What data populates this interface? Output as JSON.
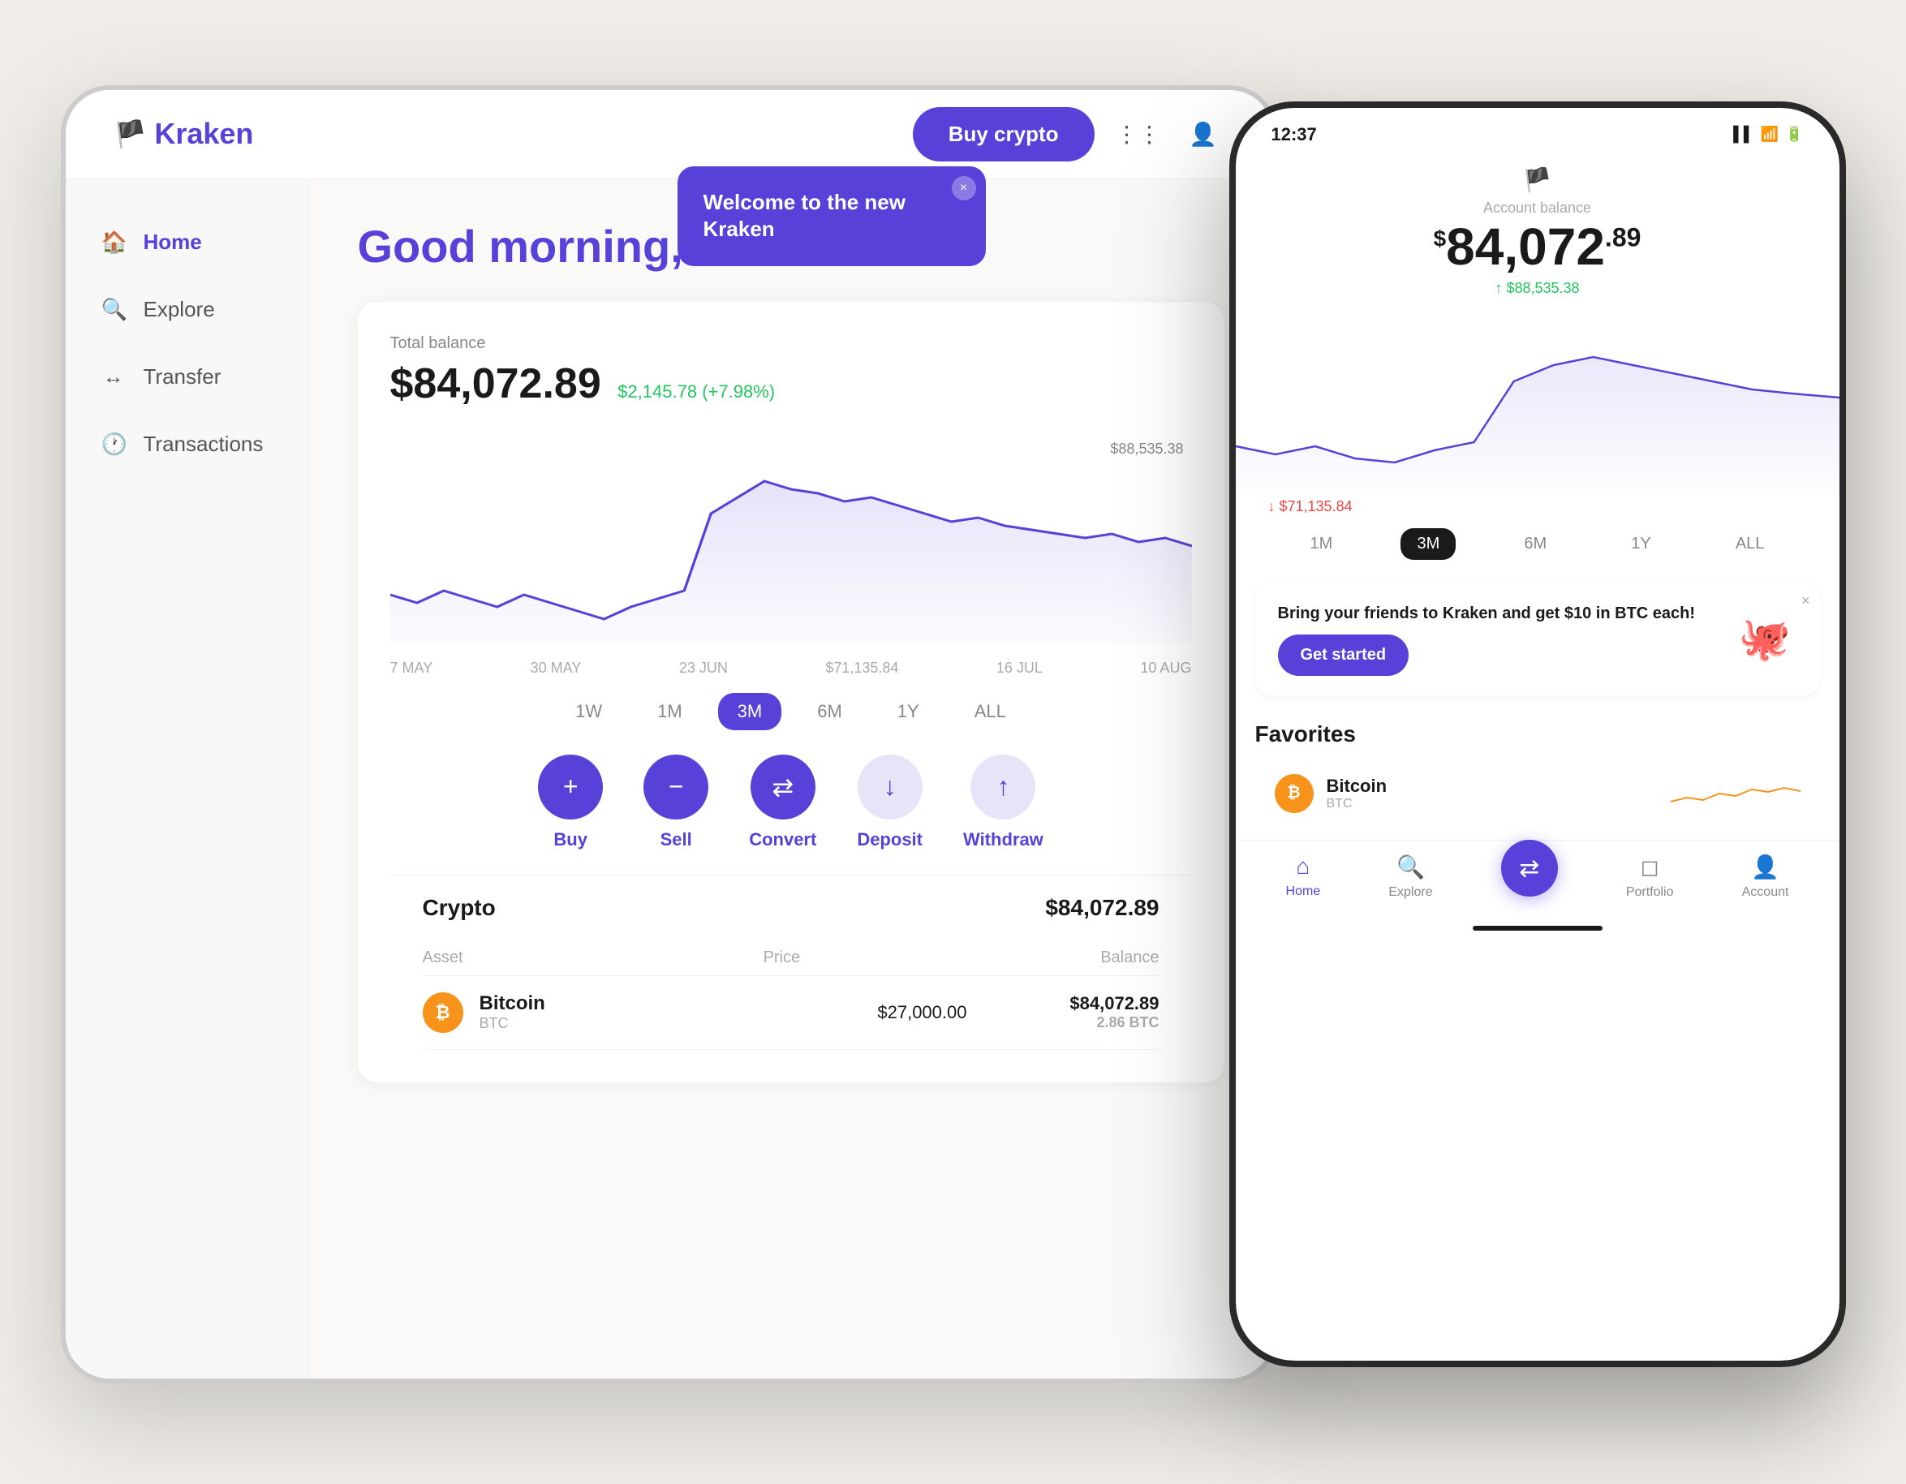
{
  "app": {
    "name": "Kraken"
  },
  "header": {
    "buy_crypto_label": "Buy crypto",
    "logo_text": "kraken"
  },
  "sidebar": {
    "items": [
      {
        "label": "Home",
        "icon": "🏠",
        "active": true
      },
      {
        "label": "Explore",
        "icon": "🔍",
        "active": false
      },
      {
        "label": "Transfer",
        "icon": "↔",
        "active": false
      },
      {
        "label": "Transactions",
        "icon": "🕐",
        "active": false
      }
    ]
  },
  "main": {
    "greeting": "Good morning, Satoshi",
    "balance": {
      "label": "Total balance",
      "amount": "$84,072.89",
      "amount_main": "$84,072.89",
      "change": "$2,145.78 (+7.98%)"
    },
    "chart": {
      "high_label": "$88,535.38",
      "low_label": "$71,135.84",
      "x_labels": [
        "7 MAY",
        "30 MAY",
        "23 JUN",
        "16 JUL",
        "10 AUG"
      ]
    },
    "time_filters": [
      "1W",
      "1M",
      "3M",
      "6M",
      "1Y",
      "ALL"
    ],
    "active_filter": "3M",
    "action_buttons": [
      {
        "label": "Buy",
        "icon": "+",
        "type": "primary"
      },
      {
        "label": "Sell",
        "icon": "−",
        "type": "primary"
      },
      {
        "label": "Convert",
        "icon": "⇄",
        "type": "primary"
      },
      {
        "label": "Deposit",
        "icon": "↓",
        "type": "light"
      },
      {
        "label": "Withdraw",
        "icon": "↑",
        "type": "light"
      }
    ],
    "assets": {
      "title": "Crypto",
      "total": "$84,072.89",
      "columns": [
        "Asset",
        "Price",
        "Balance"
      ],
      "rows": [
        {
          "name": "Bitcoin",
          "ticker": "BTC",
          "price": "$27,000.00",
          "balance": "$84,072.89",
          "sub_balance": "2.86 BTC"
        }
      ]
    }
  },
  "popup": {
    "title": "Welcome to the new Kraken",
    "close_label": "×"
  },
  "phone": {
    "status_bar": {
      "time": "12:37",
      "signal": "▌▌",
      "wifi": "WiFi",
      "battery": "🔋"
    },
    "balance": {
      "label": "Account balance",
      "main": "84,072",
      "cents": "89",
      "dollar": "$"
    },
    "chart": {
      "high_label": "↑ $88,535.38",
      "low_label": "↓ $71,135.84"
    },
    "time_filters": [
      "1M",
      "3M",
      "6M",
      "1Y",
      "ALL"
    ],
    "active_filter": "3M",
    "referral": {
      "text": "Bring your friends to Kraken and get $10 in BTC each!",
      "button_label": "Get started",
      "close": "×"
    },
    "favorites": {
      "title": "Favorites",
      "items": [
        {
          "name": "Bitcoin",
          "ticker": "BTC"
        }
      ]
    },
    "bottom_nav": [
      {
        "label": "Home",
        "icon": "⌂",
        "active": true
      },
      {
        "label": "Explore",
        "icon": "🔍",
        "active": false
      },
      {
        "label": "",
        "icon": "↔",
        "center": true
      },
      {
        "label": "Portfolio",
        "icon": "□",
        "active": false
      },
      {
        "label": "Account",
        "icon": "👤",
        "active": false
      }
    ]
  }
}
